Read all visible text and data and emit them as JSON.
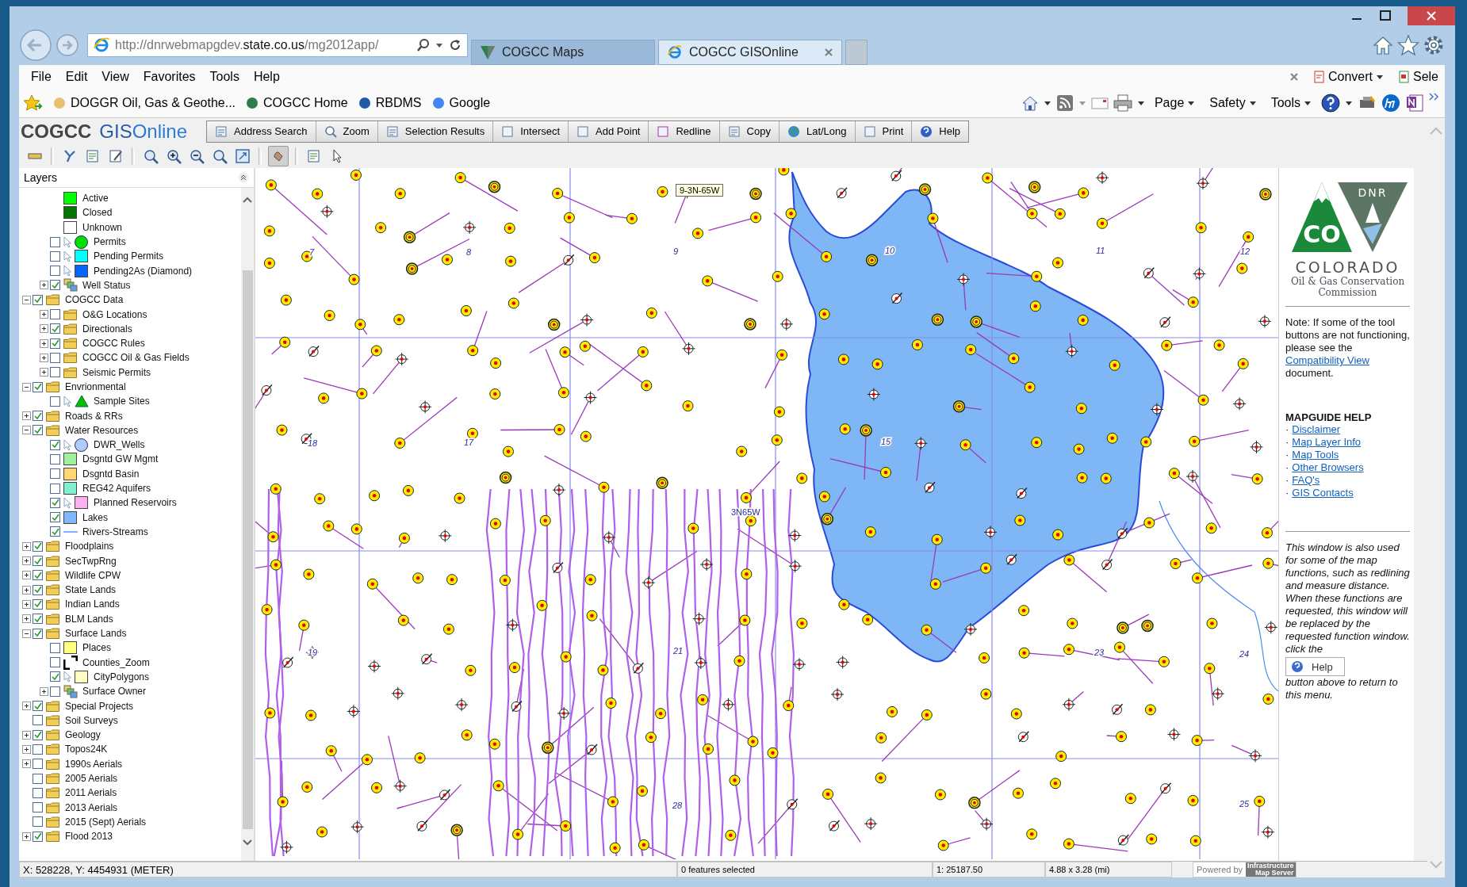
{
  "address_bar": {
    "url_start": "http://dnrwebmapgdev.",
    "url_domain": "state.co.us",
    "url_path": "/mg2012app/"
  },
  "tabs": [
    {
      "label": "COGCC Maps",
      "selected": false
    },
    {
      "label": "COGCC GISOnline",
      "selected": true
    }
  ],
  "menu": [
    "File",
    "Edit",
    "View",
    "Favorites",
    "Tools",
    "Help"
  ],
  "favorites": [
    "DOGGR Oil, Gas & Geothe...",
    "COGCC Home",
    "RBDMS",
    "Google"
  ],
  "command_bar": {
    "addons": [
      "Convert",
      "Sele"
    ],
    "menus": [
      "Page",
      "Safety",
      "Tools"
    ]
  },
  "app_header": {
    "brand": "COGCC",
    "product_a": "GIS",
    "product_b": "Online",
    "toolbar": [
      "Address Search",
      "Zoom",
      "Selection Results",
      "Intersect",
      "Add Point",
      "Redline",
      "Copy",
      "Lat/Long",
      "Print",
      "Help"
    ]
  },
  "layers": {
    "title": "Layers",
    "scrolled_items": [
      {
        "label": "Active",
        "symbol": {
          "kind": "square",
          "color": "#00ff00"
        }
      },
      {
        "label": "Closed",
        "symbol": {
          "kind": "square",
          "color": "#007700"
        }
      },
      {
        "label": "Unknown",
        "symbol": {
          "kind": "square",
          "color": "#ffffff"
        }
      },
      {
        "label": "Permits",
        "checked": false,
        "selectable": true,
        "symbol": {
          "kind": "circle",
          "color": "#00e000"
        }
      },
      {
        "label": "Pending Permits",
        "checked": false,
        "selectable": true,
        "symbol": {
          "kind": "square",
          "color": "#00ffff"
        }
      },
      {
        "label": "Pending2As (Diamond)",
        "checked": false,
        "selectable": true,
        "symbol": {
          "kind": "square",
          "color": "#0066ff"
        }
      },
      {
        "label": "Well Status",
        "checked": true,
        "expanded": false,
        "symbol": {
          "kind": "group"
        }
      }
    ],
    "items": [
      {
        "label": "COGCC Data",
        "checked": true,
        "expanded": true,
        "symbol": {
          "kind": "folder"
        },
        "children": [
          {
            "label": "O&G Locations",
            "checked": false,
            "expanded": false,
            "symbol": {
              "kind": "folder"
            }
          },
          {
            "label": "Directionals",
            "checked": true,
            "expanded": false,
            "symbol": {
              "kind": "folder"
            }
          },
          {
            "label": "COGCC Rules",
            "checked": true,
            "expanded": false,
            "symbol": {
              "kind": "folder"
            }
          },
          {
            "label": "COGCC Oil & Gas Fields",
            "checked": false,
            "expanded": false,
            "symbol": {
              "kind": "folder"
            }
          },
          {
            "label": "Seismic Permits",
            "checked": false,
            "expanded": false,
            "symbol": {
              "kind": "folder"
            }
          }
        ]
      },
      {
        "label": "Envrionmental",
        "checked": true,
        "expanded": true,
        "symbol": {
          "kind": "folder"
        },
        "children": [
          {
            "label": "Sample Sites",
            "checked": false,
            "selectable": true,
            "symbol": {
              "kind": "triangle",
              "color": "#00c000"
            }
          }
        ]
      },
      {
        "label": "Roads & RRs",
        "checked": true,
        "expanded": false,
        "symbol": {
          "kind": "folder"
        }
      },
      {
        "label": "Water Resources",
        "checked": true,
        "expanded": true,
        "symbol": {
          "kind": "folder"
        },
        "children": [
          {
            "label": "DWR_Wells",
            "checked": true,
            "selectable": true,
            "symbol": {
              "kind": "circle",
              "color": "#b0ccff"
            }
          },
          {
            "label": "Dsgntd GW Mgmt",
            "checked": false,
            "symbol": {
              "kind": "square",
              "color": "#a0f0a0"
            }
          },
          {
            "label": "Dsgntd Basin",
            "checked": false,
            "symbol": {
              "kind": "square",
              "color": "#ffd870"
            }
          },
          {
            "label": "REG42 Aquifers",
            "checked": false,
            "symbol": {
              "kind": "square",
              "color": "#80f0d0"
            }
          },
          {
            "label": "Planned Reservoirs",
            "checked": true,
            "selectable": true,
            "symbol": {
              "kind": "square",
              "color": "#ffb0f0"
            }
          },
          {
            "label": "Lakes",
            "checked": true,
            "symbol": {
              "kind": "square",
              "color": "#80b8ff"
            }
          },
          {
            "label": "Rivers-Streams",
            "checked": true,
            "symbol": {
              "kind": "line",
              "color": "#80b0ff"
            }
          }
        ]
      },
      {
        "label": "Floodplains",
        "checked": true,
        "expanded": false,
        "symbol": {
          "kind": "folder"
        }
      },
      {
        "label": "SecTwpRng",
        "checked": true,
        "expanded": false,
        "symbol": {
          "kind": "folder"
        }
      },
      {
        "label": "Wildlife CPW",
        "checked": true,
        "expanded": false,
        "symbol": {
          "kind": "folder"
        }
      },
      {
        "label": "State Lands",
        "checked": true,
        "expanded": false,
        "symbol": {
          "kind": "folder"
        }
      },
      {
        "label": "Indian Lands",
        "checked": true,
        "expanded": false,
        "symbol": {
          "kind": "folder"
        }
      },
      {
        "label": "BLM Lands",
        "checked": true,
        "expanded": false,
        "symbol": {
          "kind": "folder"
        }
      },
      {
        "label": "Surface Lands",
        "checked": true,
        "expanded": true,
        "symbol": {
          "kind": "folder"
        },
        "children": [
          {
            "label": "Places",
            "checked": false,
            "symbol": {
              "kind": "square",
              "color": "#ffff80"
            }
          },
          {
            "label": "Counties_Zoom",
            "checked": false,
            "symbol": {
              "kind": "corner"
            }
          },
          {
            "label": "CityPolygons",
            "checked": true,
            "selectable": true,
            "symbol": {
              "kind": "square",
              "color": "#ffffc0"
            }
          },
          {
            "label": "Surface Owner",
            "checked": false,
            "expanded": false,
            "symbol": {
              "kind": "group"
            }
          }
        ]
      },
      {
        "label": "Special Projects",
        "checked": true,
        "expanded": false,
        "symbol": {
          "kind": "folder"
        }
      },
      {
        "label": "Soil Surveys",
        "checked": false,
        "symbol": {
          "kind": "folder"
        }
      },
      {
        "label": "Geology",
        "checked": true,
        "expanded": false,
        "symbol": {
          "kind": "folder"
        }
      },
      {
        "label": "Topos24K",
        "checked": false,
        "expanded": false,
        "symbol": {
          "kind": "folder"
        }
      },
      {
        "label": "1990s Aerials",
        "checked": false,
        "expanded": false,
        "symbol": {
          "kind": "folder"
        }
      },
      {
        "label": "2005 Aerials",
        "checked": false,
        "symbol": {
          "kind": "folder"
        }
      },
      {
        "label": "2011 Aerials",
        "checked": false,
        "symbol": {
          "kind": "folder"
        }
      },
      {
        "label": "2013 Aerials",
        "checked": false,
        "symbol": {
          "kind": "folder"
        }
      },
      {
        "label": "2015 (Sept) Aerials",
        "checked": false,
        "symbol": {
          "kind": "folder"
        }
      },
      {
        "label": "Flood 2013",
        "checked": true,
        "expanded": false,
        "symbol": {
          "kind": "folder"
        }
      }
    ]
  },
  "map": {
    "tooltip": "9-3N-65W",
    "township_label": "3N65W",
    "section_numbers": [
      "7",
      "8",
      "9",
      "10",
      "11",
      "12",
      "18",
      "17",
      "15",
      "19",
      "21",
      "23",
      "24",
      "28",
      "25"
    ]
  },
  "info_panel": {
    "logo_left": "CO",
    "logo_right": "DNR",
    "org": "COLORADO",
    "org_sub_1": "Oil & Gas Conservation",
    "org_sub_2": "Commission",
    "note_before": "Note: If some of the tool buttons are not functioning, please see the ",
    "note_link": "Compatibility View",
    "note_after": " document.",
    "help_heading": "MAPGUIDE HELP",
    "bullet": "·",
    "help_links": [
      "Disclaimer",
      "Map Layer Info",
      "Map Tools",
      "Other Browsers",
      "FAQ's",
      "GIS Contacts"
    ],
    "window_note": "This window is also used for some of the map functions, such as redlining and measure distance. When these functions are requested, this window will be replaced by the requested function window. click the",
    "help_button": "Help",
    "window_note_end": "button above to return to this menu."
  },
  "status_bar": {
    "coordinates": "X: 528228, Y: 4454931 (METER)",
    "selection": "0 features selected",
    "scale": "1: 25187.50",
    "extent": "4.88 x 3.28 (mi)",
    "powered_by": "Powered by",
    "server_1": "Infrastructure",
    "server_2": "Map Server"
  }
}
